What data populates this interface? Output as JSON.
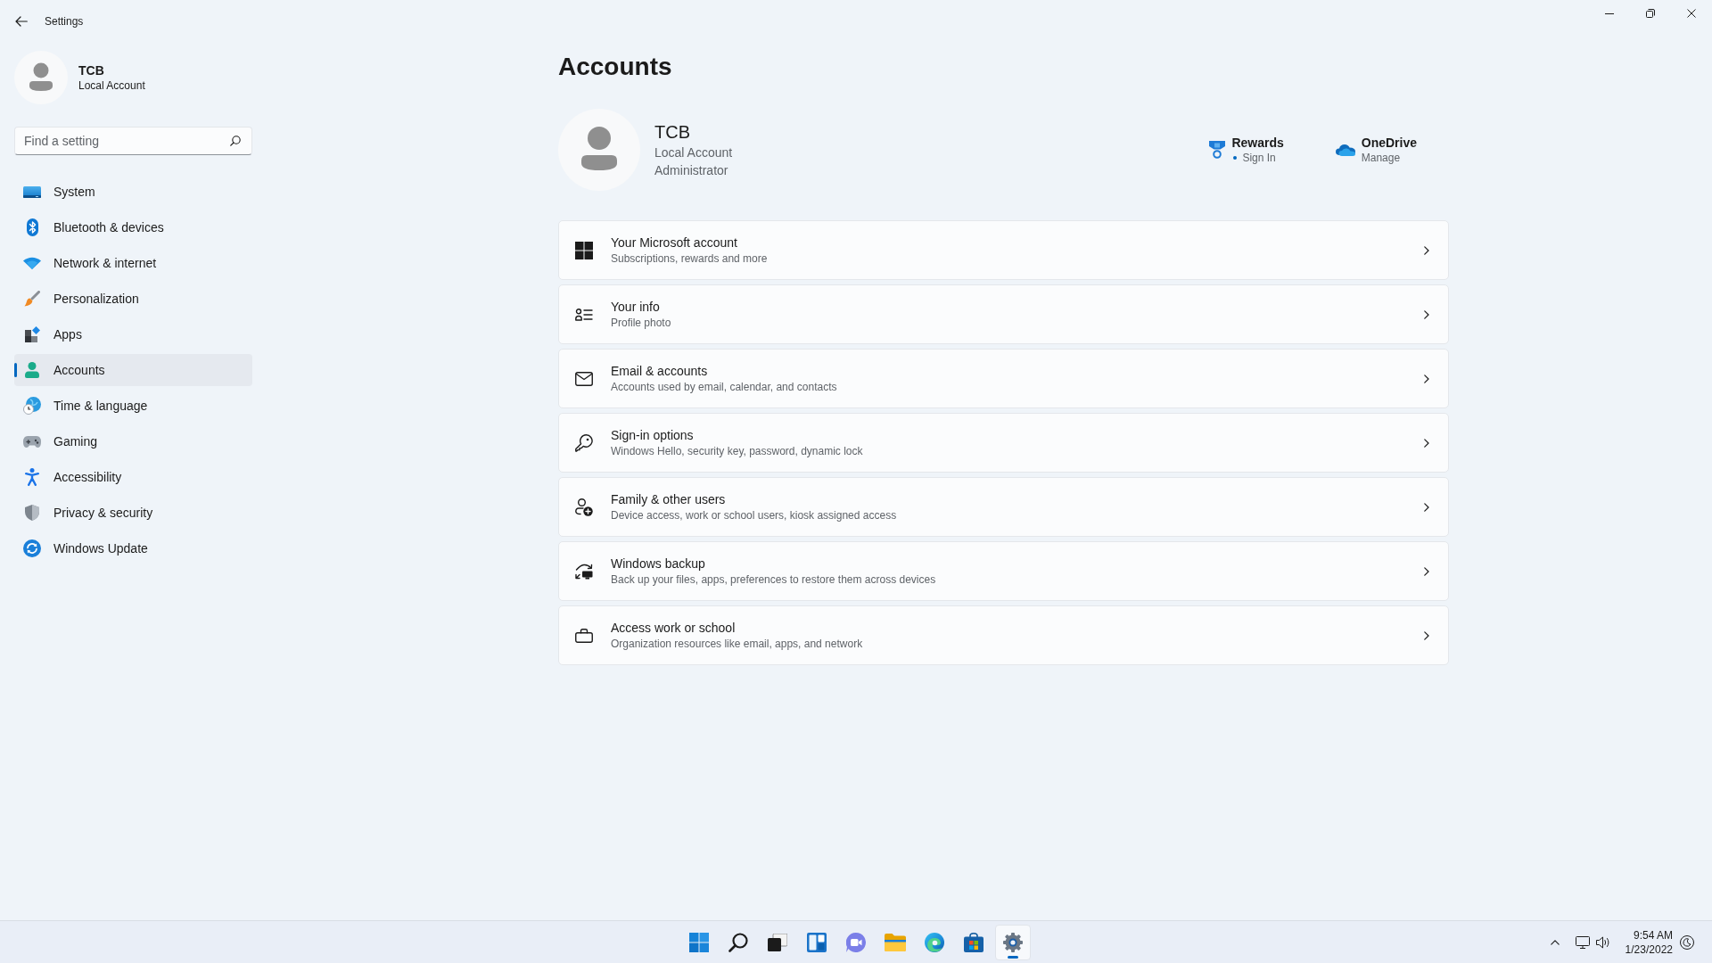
{
  "window": {
    "title": "Settings"
  },
  "sidebar": {
    "user": {
      "name": "TCB",
      "account_type": "Local Account"
    },
    "search": {
      "placeholder": "Find a setting"
    },
    "items": [
      {
        "label": "System",
        "selected": false
      },
      {
        "label": "Bluetooth & devices",
        "selected": false
      },
      {
        "label": "Network & internet",
        "selected": false
      },
      {
        "label": "Personalization",
        "selected": false
      },
      {
        "label": "Apps",
        "selected": false
      },
      {
        "label": "Accounts",
        "selected": true
      },
      {
        "label": "Time & language",
        "selected": false
      },
      {
        "label": "Gaming",
        "selected": false
      },
      {
        "label": "Accessibility",
        "selected": false
      },
      {
        "label": "Privacy & security",
        "selected": false
      },
      {
        "label": "Windows Update",
        "selected": false
      }
    ]
  },
  "page": {
    "title": "Accounts",
    "profile": {
      "name": "TCB",
      "account_type": "Local Account",
      "role": "Administrator"
    },
    "services": [
      {
        "name": "Rewards",
        "action": "Sign In",
        "alert": true
      },
      {
        "name": "OneDrive",
        "action": "Manage",
        "alert": false
      }
    ],
    "cards": [
      {
        "title": "Your Microsoft account",
        "subtitle": "Subscriptions, rewards and more"
      },
      {
        "title": "Your info",
        "subtitle": "Profile photo"
      },
      {
        "title": "Email & accounts",
        "subtitle": "Accounts used by email, calendar, and contacts"
      },
      {
        "title": "Sign-in options",
        "subtitle": "Windows Hello, security key, password, dynamic lock"
      },
      {
        "title": "Family & other users",
        "subtitle": "Device access, work or school users, kiosk assigned access"
      },
      {
        "title": "Windows backup",
        "subtitle": "Back up your files, apps, preferences to restore them across devices"
      },
      {
        "title": "Access work or school",
        "subtitle": "Organization resources like email, apps, and network"
      }
    ]
  },
  "taskbar": {
    "apps": [
      {
        "active": false
      },
      {
        "active": false
      },
      {
        "active": false
      },
      {
        "active": false
      },
      {
        "active": false
      },
      {
        "active": false
      },
      {
        "active": false
      },
      {
        "active": false
      },
      {
        "active": true
      }
    ],
    "clock": {
      "time": "9:54 AM",
      "date": "1/23/2022"
    }
  }
}
